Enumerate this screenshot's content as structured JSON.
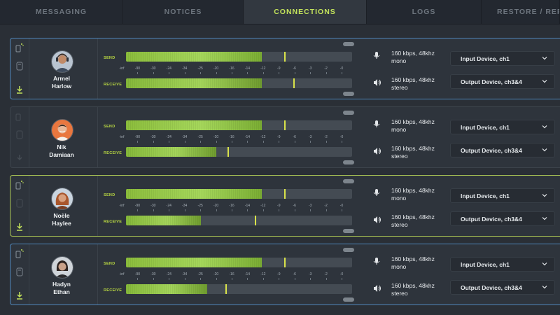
{
  "tabs": [
    {
      "label": "MESSAGING"
    },
    {
      "label": "NOTICES"
    },
    {
      "label": "CONNECTIONS",
      "active": true
    },
    {
      "label": "LOGS"
    },
    {
      "label": "RESTORE / REPLA"
    }
  ],
  "meter_labels": {
    "send": "SEND",
    "receive": "RECEIVE"
  },
  "scale_ticks": [
    "-inf",
    "-90",
    "-30",
    "-24",
    "-34",
    "-25",
    "-20",
    "-16",
    "-14",
    "-12",
    "-9",
    "-6",
    "-3",
    "-2",
    "-0"
  ],
  "colors": {
    "accent": "#c3e35b",
    "meter": "#9ecf52",
    "selected_blue": "#4f86b9",
    "selected_green": "#aac554"
  },
  "icons": {
    "mic": "microphone-icon",
    "speaker": "speaker-icon",
    "download": "download-icon"
  },
  "rows": [
    {
      "first": "Armel",
      "last": "Harlow",
      "send_level": 0.6,
      "send_peak": 0.7,
      "receive_level": 0.6,
      "receive_peak": 0.74,
      "send_format": {
        "line1": "160 kbps, 48khz",
        "line2": "mono"
      },
      "receive_format": {
        "line1": "160 kbps, 48khz",
        "line2": "stereo"
      },
      "input_device": "Input Device, ch1",
      "output_device": "Output Device, ch3&4"
    },
    {
      "first": "Nik",
      "last": "Damiaan",
      "send_level": 0.6,
      "send_peak": 0.7,
      "receive_level": 0.4,
      "receive_peak": 0.45,
      "send_format": {
        "line1": "160 kbps, 48khz",
        "line2": "mono"
      },
      "receive_format": {
        "line1": "160 kbps, 48khz",
        "line2": "stereo"
      },
      "input_device": "Input Device, ch1",
      "output_device": "Output Device, ch3&4"
    },
    {
      "first": "Noële",
      "last": "Haylee",
      "send_level": 0.6,
      "send_peak": 0.7,
      "receive_level": 0.33,
      "receive_peak": 0.57,
      "send_format": {
        "line1": "160 kbps, 48khz",
        "line2": "mono"
      },
      "receive_format": {
        "line1": "160 kbps, 48khz",
        "line2": "stereo"
      },
      "input_device": "Input Device, ch1",
      "output_device": "Output Device, ch3&4"
    },
    {
      "first": "Hadyn",
      "last": "Ethan",
      "send_level": 0.6,
      "send_peak": 0.7,
      "receive_level": 0.36,
      "receive_peak": 0.44,
      "send_format": {
        "line1": "160 kbps, 48khz",
        "line2": "mono"
      },
      "receive_format": {
        "line1": "160 kbps, 48khz",
        "line2": "stereo"
      },
      "input_device": "Input Device, ch1",
      "output_device": "Output Device, ch3&4"
    }
  ]
}
